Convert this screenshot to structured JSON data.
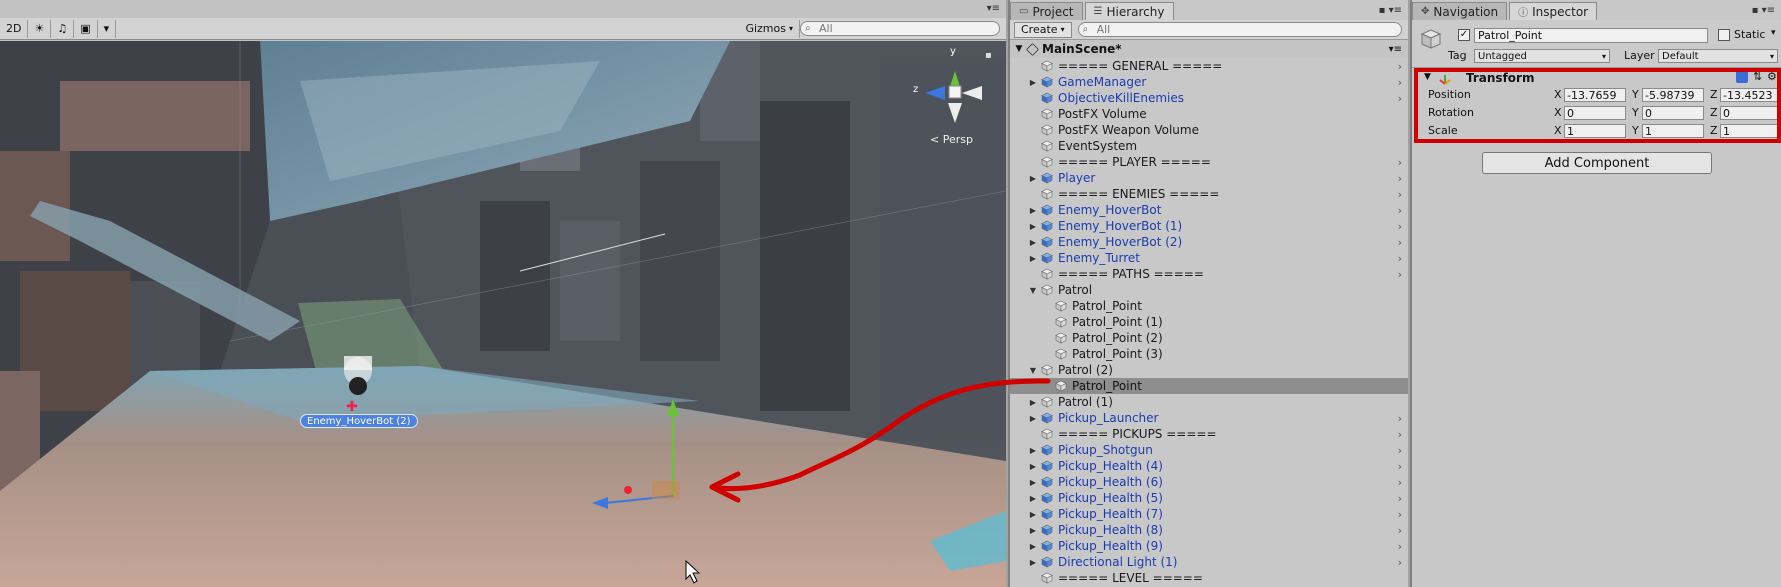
{
  "scene": {
    "toolbar": {
      "mode_2d": "2D",
      "gizmos_label": "Gizmos",
      "search_placeholder": "All"
    },
    "view_label": "< Persp",
    "object_label": "Enemy_HoverBot (2)"
  },
  "hierarchy": {
    "tabs": [
      {
        "label": "Project"
      },
      {
        "label": "Hierarchy"
      }
    ],
    "create_label": "Create",
    "search_placeholder": "All",
    "scene_name": "MainScene*",
    "items": [
      {
        "label": "===== GENERAL ====="
      },
      {
        "label": "GameManager"
      },
      {
        "label": "ObjectiveKillEnemies"
      },
      {
        "label": "PostFX Volume"
      },
      {
        "label": "PostFX Weapon Volume"
      },
      {
        "label": "EventSystem"
      },
      {
        "label": "===== PLAYER ====="
      },
      {
        "label": "Player"
      },
      {
        "label": "===== ENEMIES ====="
      },
      {
        "label": "Enemy_HoverBot"
      },
      {
        "label": "Enemy_HoverBot (1)"
      },
      {
        "label": "Enemy_HoverBot (2)"
      },
      {
        "label": "Enemy_Turret"
      },
      {
        "label": "===== PATHS ====="
      },
      {
        "label": "Patrol"
      },
      {
        "label": "Patrol_Point"
      },
      {
        "label": "Patrol_Point (1)"
      },
      {
        "label": "Patrol_Point (2)"
      },
      {
        "label": "Patrol_Point (3)"
      },
      {
        "label": "Patrol (2)"
      },
      {
        "label": "Patrol_Point"
      },
      {
        "label": "Patrol (1)"
      },
      {
        "label": "Pickup_Launcher"
      },
      {
        "label": "===== PICKUPS ====="
      },
      {
        "label": "Pickup_Shotgun"
      },
      {
        "label": "Pickup_Health (4)"
      },
      {
        "label": "Pickup_Health (6)"
      },
      {
        "label": "Pickup_Health (5)"
      },
      {
        "label": "Pickup_Health (7)"
      },
      {
        "label": "Pickup_Health (8)"
      },
      {
        "label": "Pickup_Health (9)"
      },
      {
        "label": "Directional Light (1)"
      },
      {
        "label": "===== LEVEL ====="
      }
    ]
  },
  "inspector": {
    "tabs": [
      {
        "label": "Navigation"
      },
      {
        "label": "Inspector"
      }
    ],
    "object_name": "Patrol_Point",
    "static_label": "Static",
    "tag_label": "Tag",
    "tag_value": "Untagged",
    "layer_label": "Layer",
    "layer_value": "Default",
    "component_title": "Transform",
    "position_label": "Position",
    "rotation_label": "Rotation",
    "scale_label": "Scale",
    "axis_x": "X",
    "axis_y": "Y",
    "axis_z": "Z",
    "position": {
      "x": "-13.7659",
      "y": "-5.98739",
      "z": "-13.4523"
    },
    "rotation": {
      "x": "0",
      "y": "0",
      "z": "0"
    },
    "scale": {
      "x": "1",
      "y": "1",
      "z": "1"
    },
    "add_component_label": "Add Component"
  },
  "colors": {
    "prefab_text": "#1b3bb0",
    "annotation_red": "#d10000",
    "selection_row": "#8e8e8e"
  },
  "icons": [
    "sun-icon",
    "audio-icon",
    "image-icon",
    "folder-icon",
    "list-icon",
    "lock-icon",
    "navigation-icon",
    "info-icon",
    "unity-scene-icon",
    "cube-icon",
    "gear-icon"
  ]
}
